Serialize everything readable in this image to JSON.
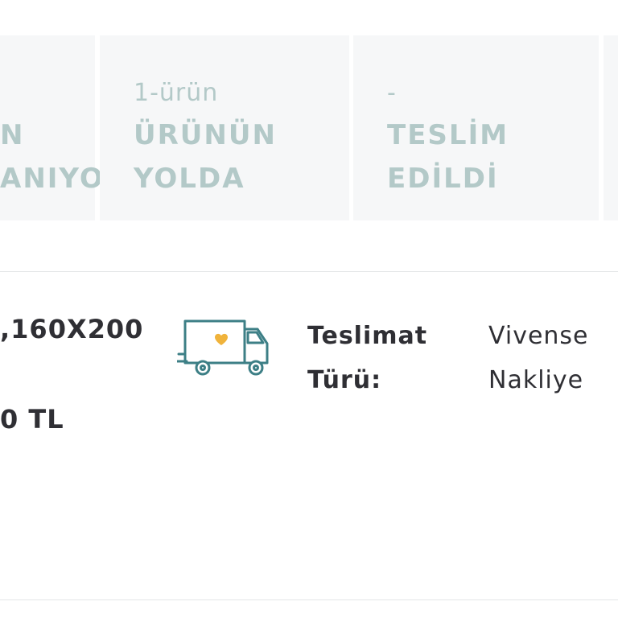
{
  "status_steps": [
    {
      "top": "",
      "line1": "N",
      "line2": "ANIYOR"
    },
    {
      "top": "1-ürün",
      "line1": "ÜRÜNÜN",
      "line2": "YOLDA"
    },
    {
      "top": "-",
      "line1": "TESLİM",
      "line2": "EDİLDİ"
    }
  ],
  "product": {
    "name": ",160X200",
    "price": "0 TL"
  },
  "delivery": {
    "label_line1": "Teslimat",
    "label_line2": "Türü:",
    "value_line1": "Vivense",
    "value_line2": "Nakliye",
    "icon": "delivery-truck-heart-icon"
  },
  "colors": {
    "status_text": "#b3c9c8",
    "status_bg": "#f6f7f8",
    "icon_stroke": "#3d7f86",
    "heart": "#f0b33b",
    "body_text": "#2f2f34"
  }
}
